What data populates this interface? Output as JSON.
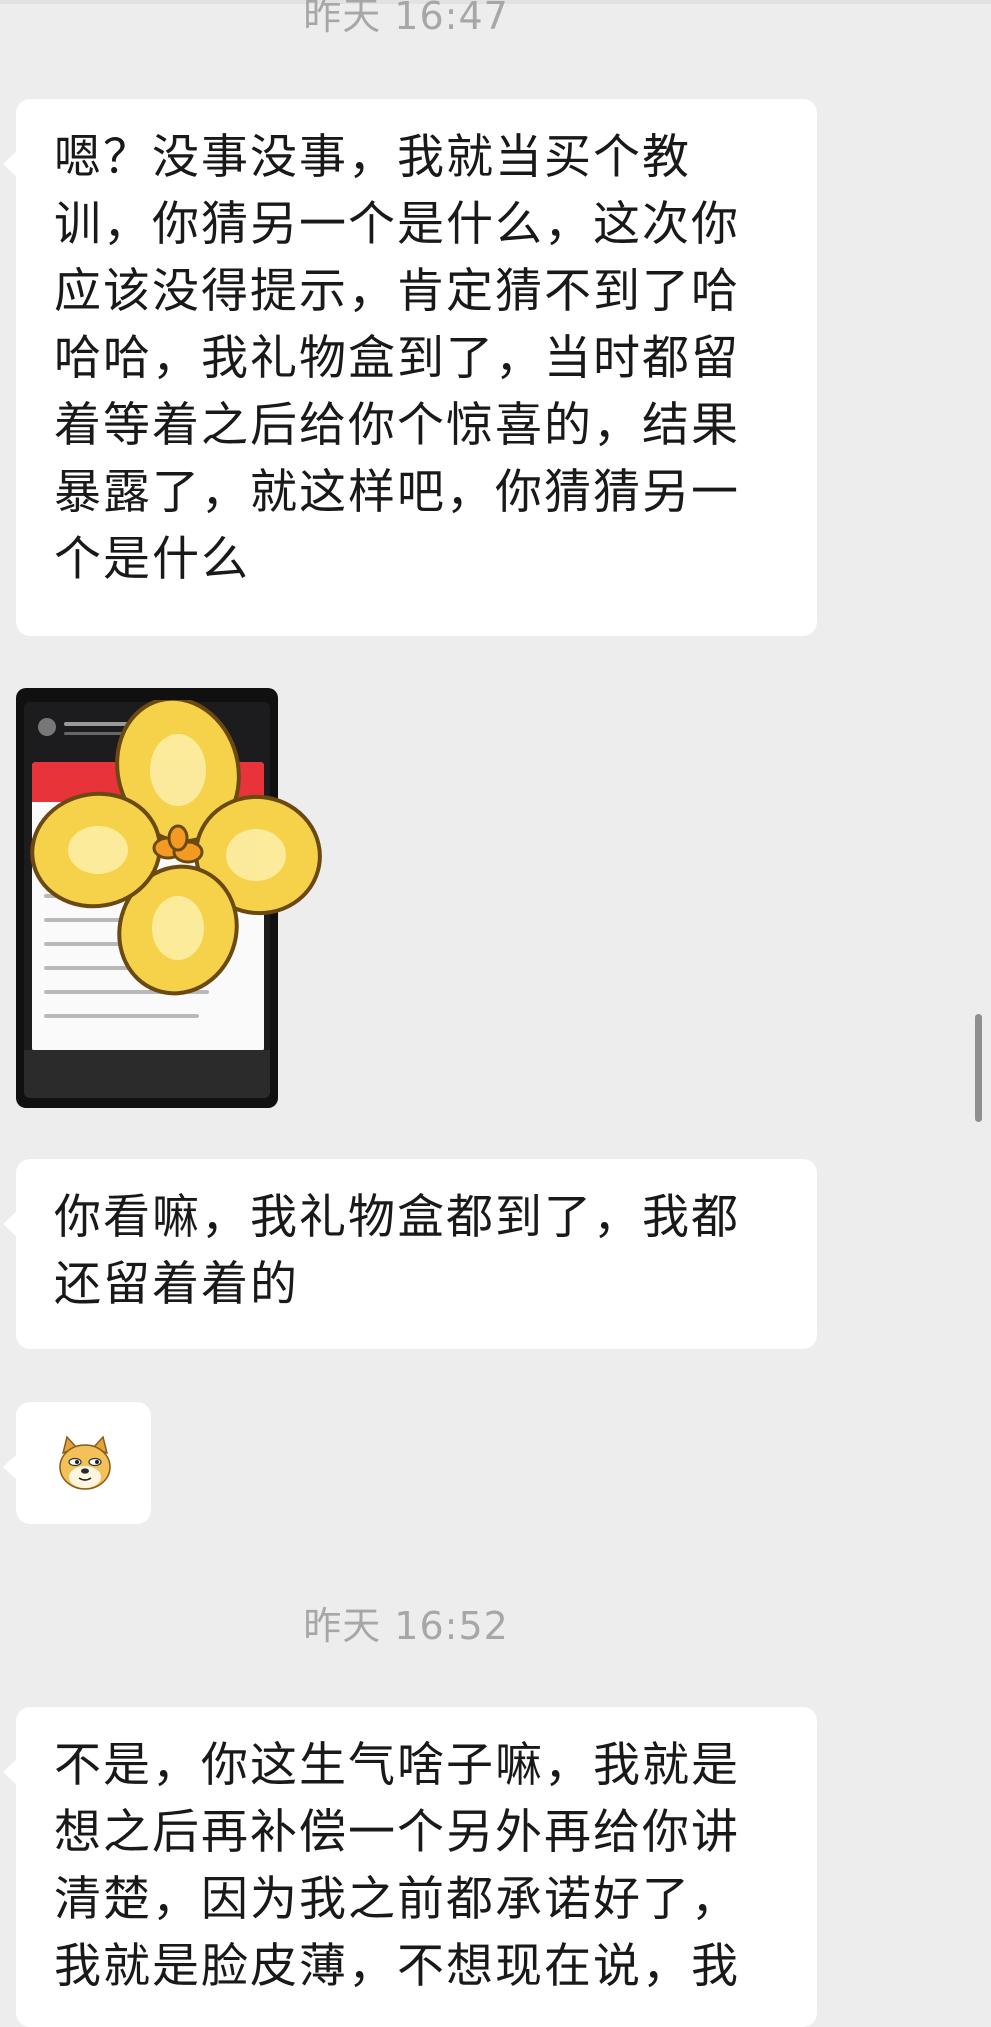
{
  "chat": {
    "timestamps": [
      "昨天 16:47",
      "昨天 16:52"
    ],
    "messages": [
      {
        "type": "text",
        "text": "嗯？没事没事，我就当买个教训，你猜另一个是什么，这次你应该没得提示，肯定猜不到了哈哈哈，我礼物盒到了，当时都留着等着之后给你个惊喜的，结果暴露了，就这样吧，你猜猜另一个是什么"
      },
      {
        "type": "image",
        "description_icon": "flower-sticker-icon"
      },
      {
        "type": "text",
        "text": "你看嘛，我礼物盒都到了，我都还留着着的"
      },
      {
        "type": "emoji",
        "icon": "doge-emoji-icon"
      },
      {
        "type": "text",
        "text": "不是，你这生气啥子嘛，我就是想之后再补偿一个另外再给你讲清楚，因为我之前都承诺好了，我就是脸皮薄，不想现在说，我"
      }
    ]
  },
  "colors": {
    "background": "#ededed",
    "bubble": "#ffffff",
    "text": "#191919",
    "timestamp": "#a7a7a7"
  }
}
